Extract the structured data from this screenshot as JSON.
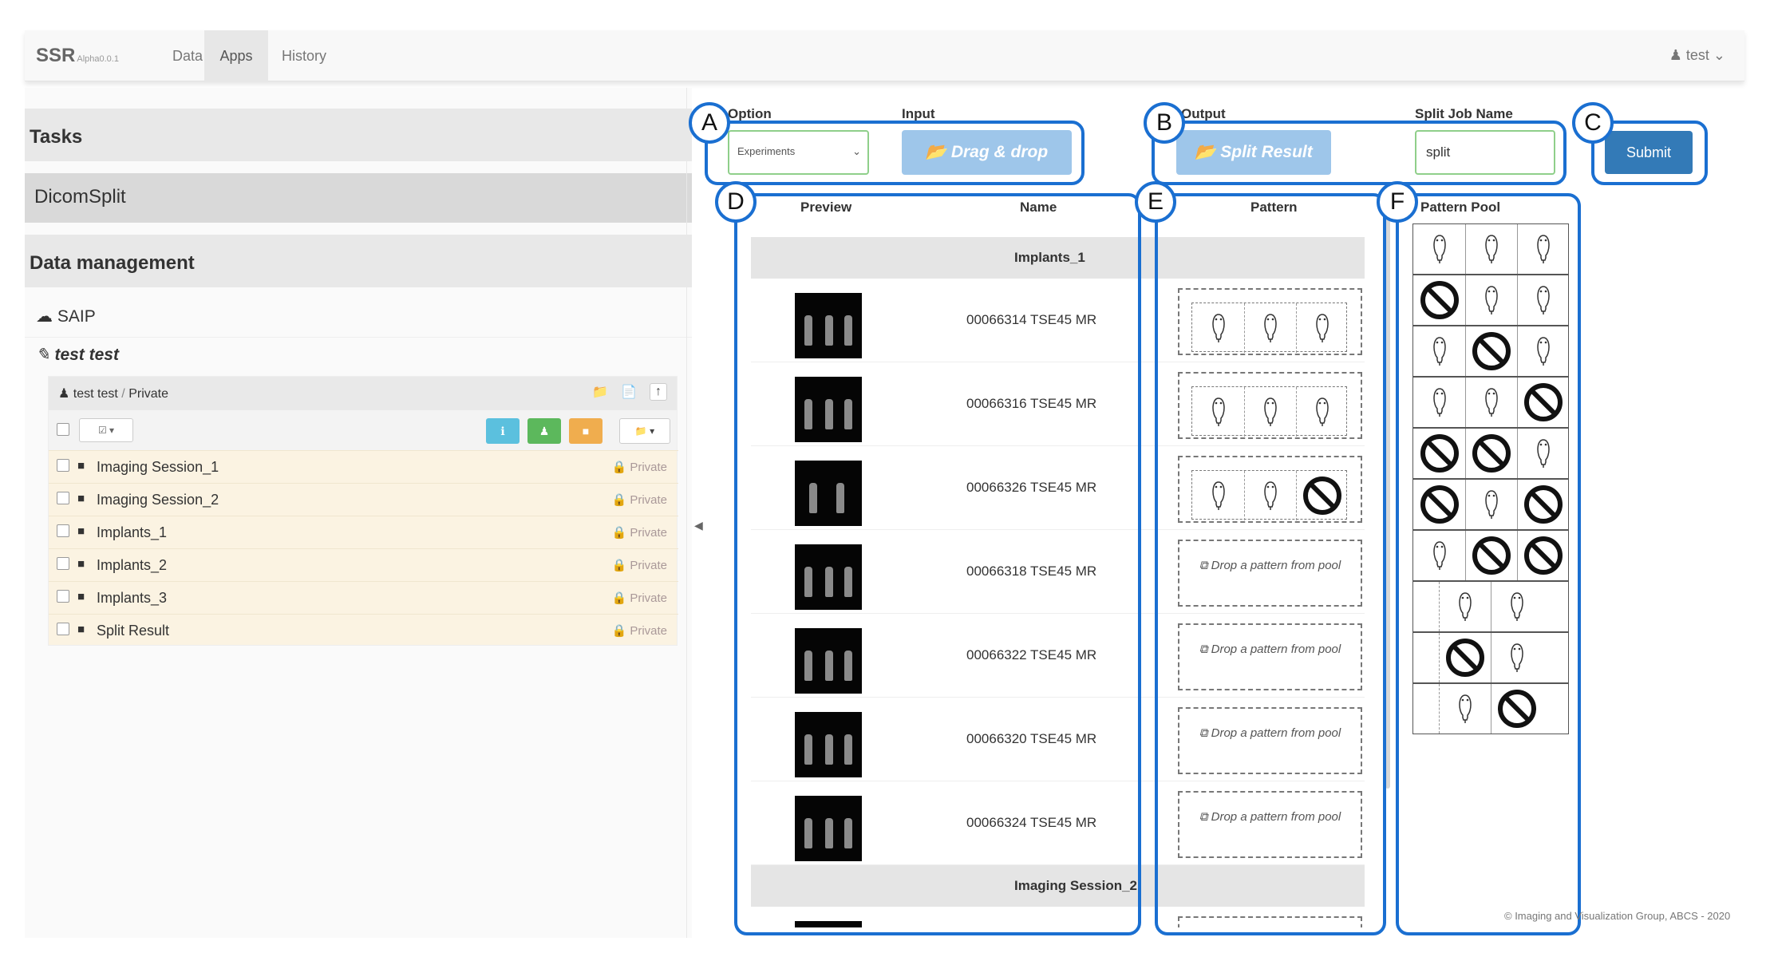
{
  "navbar": {
    "brand": "SSR",
    "brand_sub": "Alpha0.0.1",
    "links": [
      "Data",
      "Apps",
      "History"
    ],
    "active": "Apps",
    "user": "test"
  },
  "left": {
    "tasks_heading": "Tasks",
    "task_item": "DicomSplit",
    "data_heading": "Data management",
    "cloud_item": "SAIP",
    "user_item": "test test",
    "card": {
      "owner": "test test",
      "sep": "/",
      "visibility": "Private",
      "folders": [
        {
          "name": "Imaging Session_1",
          "status": "Private"
        },
        {
          "name": "Imaging Session_2",
          "status": "Private"
        },
        {
          "name": "Implants_1",
          "status": "Private"
        },
        {
          "name": "Implants_2",
          "status": "Private"
        },
        {
          "name": "Implants_3",
          "status": "Private"
        },
        {
          "name": "Split Result",
          "status": "Private"
        }
      ]
    }
  },
  "form": {
    "option_label": "Option",
    "option_value": "Experiments",
    "input_label": "Input",
    "drag_drop": "Drag & drop",
    "output_label": "Output",
    "split_result": "Split Result",
    "job_label": "Split Job Name",
    "job_value": "split",
    "submit": "Submit"
  },
  "table": {
    "headers": {
      "preview": "Preview",
      "name": "Name",
      "pattern": "Pattern",
      "pool": "Pattern Pool"
    },
    "groups": [
      {
        "title": "Implants_1",
        "rows": [
          {
            "name": "00066314 TSE45 MR",
            "vials": 3
          },
          {
            "name": "00066316 TSE45 MR",
            "vials": 3
          },
          {
            "name": "00066326 TSE45 MR",
            "vials": 2
          },
          {
            "name": "00066318 TSE45 MR",
            "vials": 3
          },
          {
            "name": "00066322 TSE45 MR",
            "vials": 3
          },
          {
            "name": "00066320 TSE45 MR",
            "vials": 3
          },
          {
            "name": "00066324 TSE45 MR",
            "vials": 3
          }
        ]
      },
      {
        "title": "Imaging Session_2",
        "rows": []
      }
    ],
    "drop_hint": "Drop a pattern from pool",
    "assigned_patterns": [
      [
        "mouse",
        "mouse",
        "mouse"
      ],
      [
        "mouse",
        "mouse",
        "mouse"
      ],
      [
        "mouse",
        "mouse",
        "no"
      ]
    ],
    "pool": [
      [
        "mouse",
        "mouse",
        "mouse"
      ],
      [
        "no",
        "mouse",
        "mouse"
      ],
      [
        "mouse",
        "no",
        "mouse"
      ],
      [
        "mouse",
        "mouse",
        "no"
      ],
      [
        "no",
        "no",
        "mouse"
      ],
      [
        "no",
        "mouse",
        "no"
      ],
      [
        "mouse",
        "no",
        "no"
      ],
      [
        "mouse",
        "mouse"
      ],
      [
        "no",
        "mouse"
      ],
      [
        "mouse",
        "no"
      ]
    ]
  },
  "callouts": [
    "A",
    "B",
    "C",
    "D",
    "E",
    "F"
  ],
  "footer": "© Imaging and Visualization Group, ABCS - 2020",
  "colors": {
    "callout": "#1a6fd1",
    "primary": "#337ab7",
    "light_btn": "#9ec6ea",
    "info": "#5bc0de",
    "success": "#5cb85c",
    "warning": "#f0ad4e"
  }
}
